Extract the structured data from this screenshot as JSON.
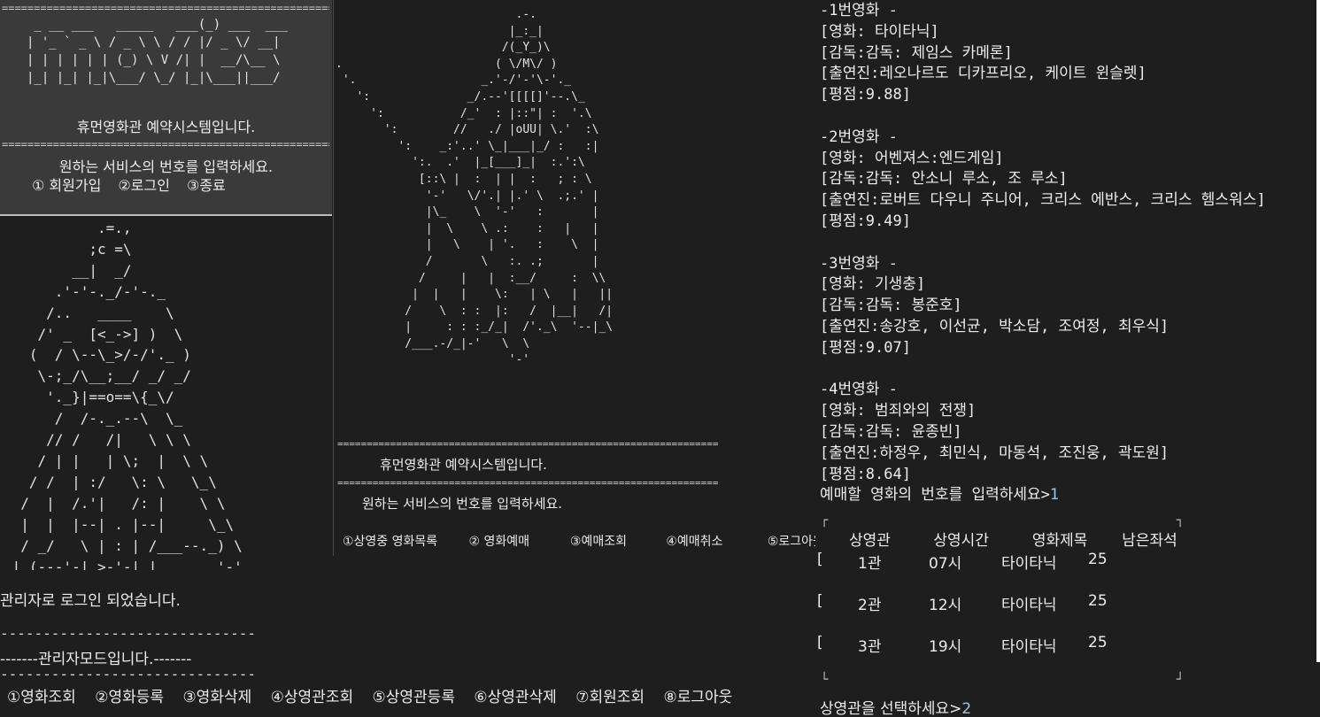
{
  "top_left": {
    "rule": "=================================================================",
    "logo_lines": [
      " _ __ ___   _____   ___(_) ___  ___",
      "| '_ ` _ \\ / _ \\ \\ / / |/ _ \\/ __|",
      "| | | | | | (_) \\ V /| |  __/\\__ \\",
      "|_| |_| |_|\\___/ \\_/ |_|\\___||___/"
    ],
    "title": "휴먼영화관 예약시스템입니다.",
    "prompt": "원하는 서비스의 번호를 입력하세요.",
    "menu": [
      "① 회원가입",
      "②로그인",
      "③종료"
    ]
  },
  "left_art": [
    "           .=.,",
    "          ;c =\\",
    "        __|  _/",
    "      .'-'-._/-'-._",
    "     /..   ____    \\",
    "    /' _  [<_->] )  \\",
    "   (  / \\--\\_>/-/'._ )",
    "    \\-;_/\\__;__/ _/ _/",
    "     '._}|==o==\\{_\\/",
    "      /  /-._.--\\  \\_",
    "     // /   /|   \\ \\ \\",
    "    / | |   | \\;  |  \\ \\",
    "   / /  | :/   \\: \\   \\_\\",
    "  /  |  /.'|   /: |    \\ \\",
    "  |  |  |--| . |--|     \\_\\",
    "  / _/   \\ | : | /___--._) \\",
    " |_(---'-| >-'-| |       '-'",
    "        /_/     \\_\\"
  ],
  "middle": {
    "art": [
      "                          .-.",
      "                         |_:_|",
      "                        /(_Y_)\\",
      ".                      ( \\/M\\/ )",
      " '.                  _.'-/'-'\\-'._",
      "   ':              _/.--'[[[[]'--.\\_",
      "     ':           /_'  : |::\"| :  '.\\",
      "       ':        //   ./ |oUU| \\.'  :\\",
      "         ':    _:'..' \\_|___|_/ :   :|",
      "           ':.  .'  |_[___]_|  :.':\\",
      "            [::\\ |  :  | |  :   ; : \\",
      "             '-'   \\/'.| |.' \\  .;.' |",
      "             |\\_    \\  '-'   :       |",
      "             |  \\    \\ .:    :   |   |",
      "             |   \\    | '.   :    \\  |",
      "             /       \\   :. .;       |",
      "            /     |   |  :__/     :  \\\\",
      "           |  |   |    \\:   | \\   |   ||",
      "          /    \\  : :  |:   /  |__|   /|",
      "          |     : : :_/_|  /'._\\  '--|_\\",
      "          /___.-/_|-'   \\  \\",
      "                         '-'"
    ],
    "rule": "=================================================================",
    "title": "휴먼영화관 예약시스템입니다.",
    "prompt": "원하는 서비스의 번호를 입력하세요.",
    "menu": [
      "①상영중 영화목록",
      "② 영화예매",
      "③예매조회",
      "④예매취소",
      "⑤로그아웃"
    ]
  },
  "bottom_left": {
    "login_msg": "관리자로 로그인 되었습니다.",
    "dash": "------------------------------",
    "mode_line": "-------관리자모드입니다.-------",
    "menu": [
      "①영화조회",
      "②영화등록",
      "③영화삭제",
      "④상영관조회",
      "⑤상영관등록",
      "⑥상영관삭제",
      "⑦회원조회",
      "⑧로그아웃"
    ]
  },
  "right": {
    "movie_lines": [
      "-1번영화 -",
      "[영화: 타이타닉]",
      "[감독:감독: 제임스 카메론]",
      "[출연진:레오나르도 디카프리오, 케이트 윈슬렛]",
      "[평점:9.88]",
      "",
      "-2번영화 -",
      "[영화: 어벤져스:엔드게임]",
      "[감독:감독: 안소니 루소, 조 루소]",
      "[출연진:로버트 다우니 주니어, 크리스 에반스, 크리스 헴스워스]",
      "[평점:9.49]",
      "",
      "-3번영화 -",
      "[영화: 기생충]",
      "[감독:감독: 봉준호]",
      "[출연진:송강호, 이선균, 박소담, 조여정, 최우식]",
      "[평점:9.07]",
      "",
      "-4번영화 -",
      "[영화: 범죄와의 전쟁]",
      "[감독:감독: 윤종빈]",
      "[출연진:하정우, 최민식, 마동석, 조진웅, 곽도원]",
      "[평점:8.64]"
    ],
    "ask_movie": "예매할 영화의 번호를 입력하세요>",
    "ask_movie_answer": "1",
    "table_headers": [
      "상영관",
      "상영시간",
      "영화제목",
      "남은좌석"
    ],
    "table_rows": [
      {
        "hall": "1관",
        "time": "07시",
        "title": "타이타닉",
        "seats": "25"
      },
      {
        "hall": "2관",
        "time": "12시",
        "title": "타이타닉",
        "seats": "25"
      },
      {
        "hall": "3관",
        "time": "19시",
        "title": "타이타닉",
        "seats": "25"
      }
    ],
    "row_bracket": "[",
    "ask_hall": "상영관을 선택하세요>",
    "ask_hall_answer": "2"
  }
}
